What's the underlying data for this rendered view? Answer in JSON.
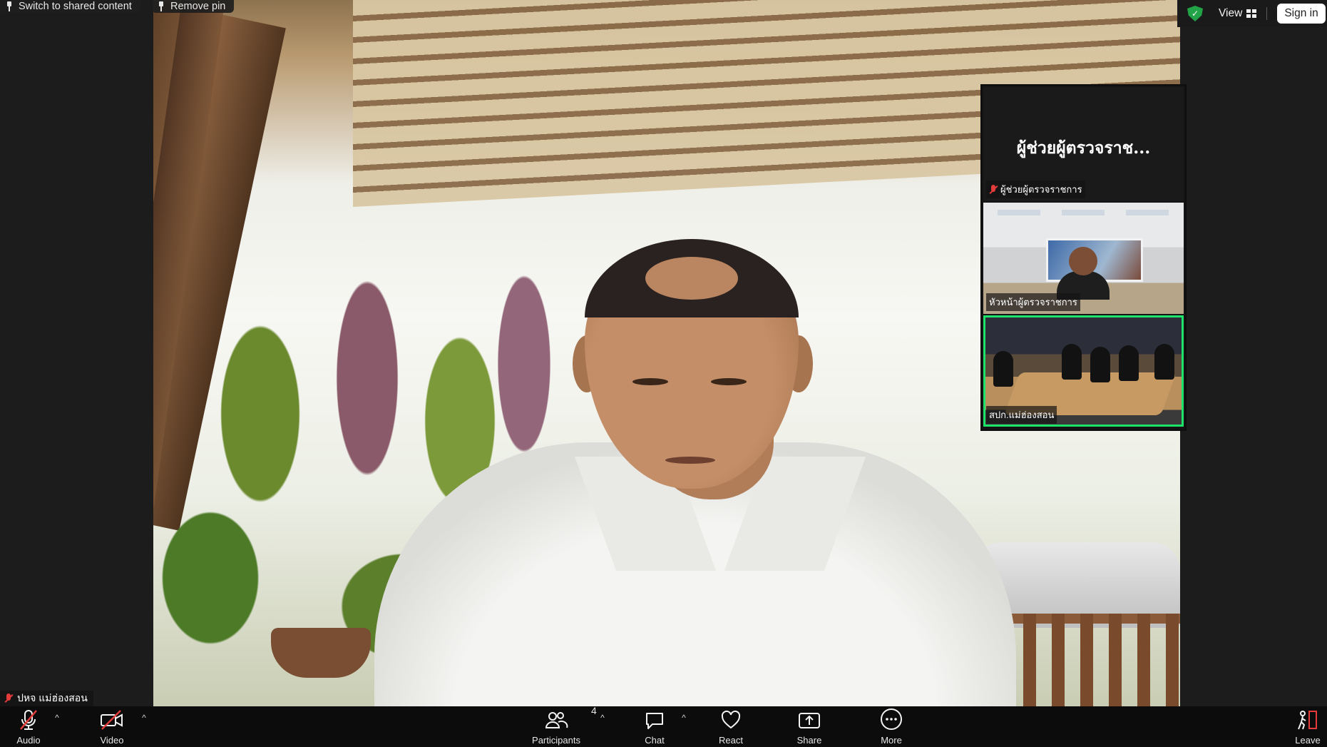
{
  "top_overlays": {
    "switch_label": "Switch to shared content",
    "remove_pin_label": "Remove pin"
  },
  "top_right": {
    "view_label": "View",
    "signin_label": "Sign in",
    "security_color": "#23a347"
  },
  "main_video": {
    "participant_name": "ปหจ แม่ฮ่องสอน",
    "muted": true
  },
  "thumbnails": [
    {
      "display_name": "ผู้ช่วยผู้ตรวจราช...",
      "label": "ผู้ช่วยผู้ตรวจราชการ",
      "muted": true,
      "video": false
    },
    {
      "label": "หัวหน้าผู้ตรวจราชการ",
      "muted": false,
      "video": true
    },
    {
      "label": "สปก.แม่ฮ่องสอน",
      "muted": false,
      "video": true,
      "active_speaker": true
    }
  ],
  "toolbar": {
    "audio_label": "Audio",
    "video_label": "Video",
    "participants_label": "Participants",
    "participants_count": "4",
    "chat_label": "Chat",
    "react_label": "React",
    "share_label": "Share",
    "more_label": "More",
    "leave_label": "Leave",
    "active_speaker_color": "#1ee36a",
    "muted_color": "#e43b3b"
  }
}
